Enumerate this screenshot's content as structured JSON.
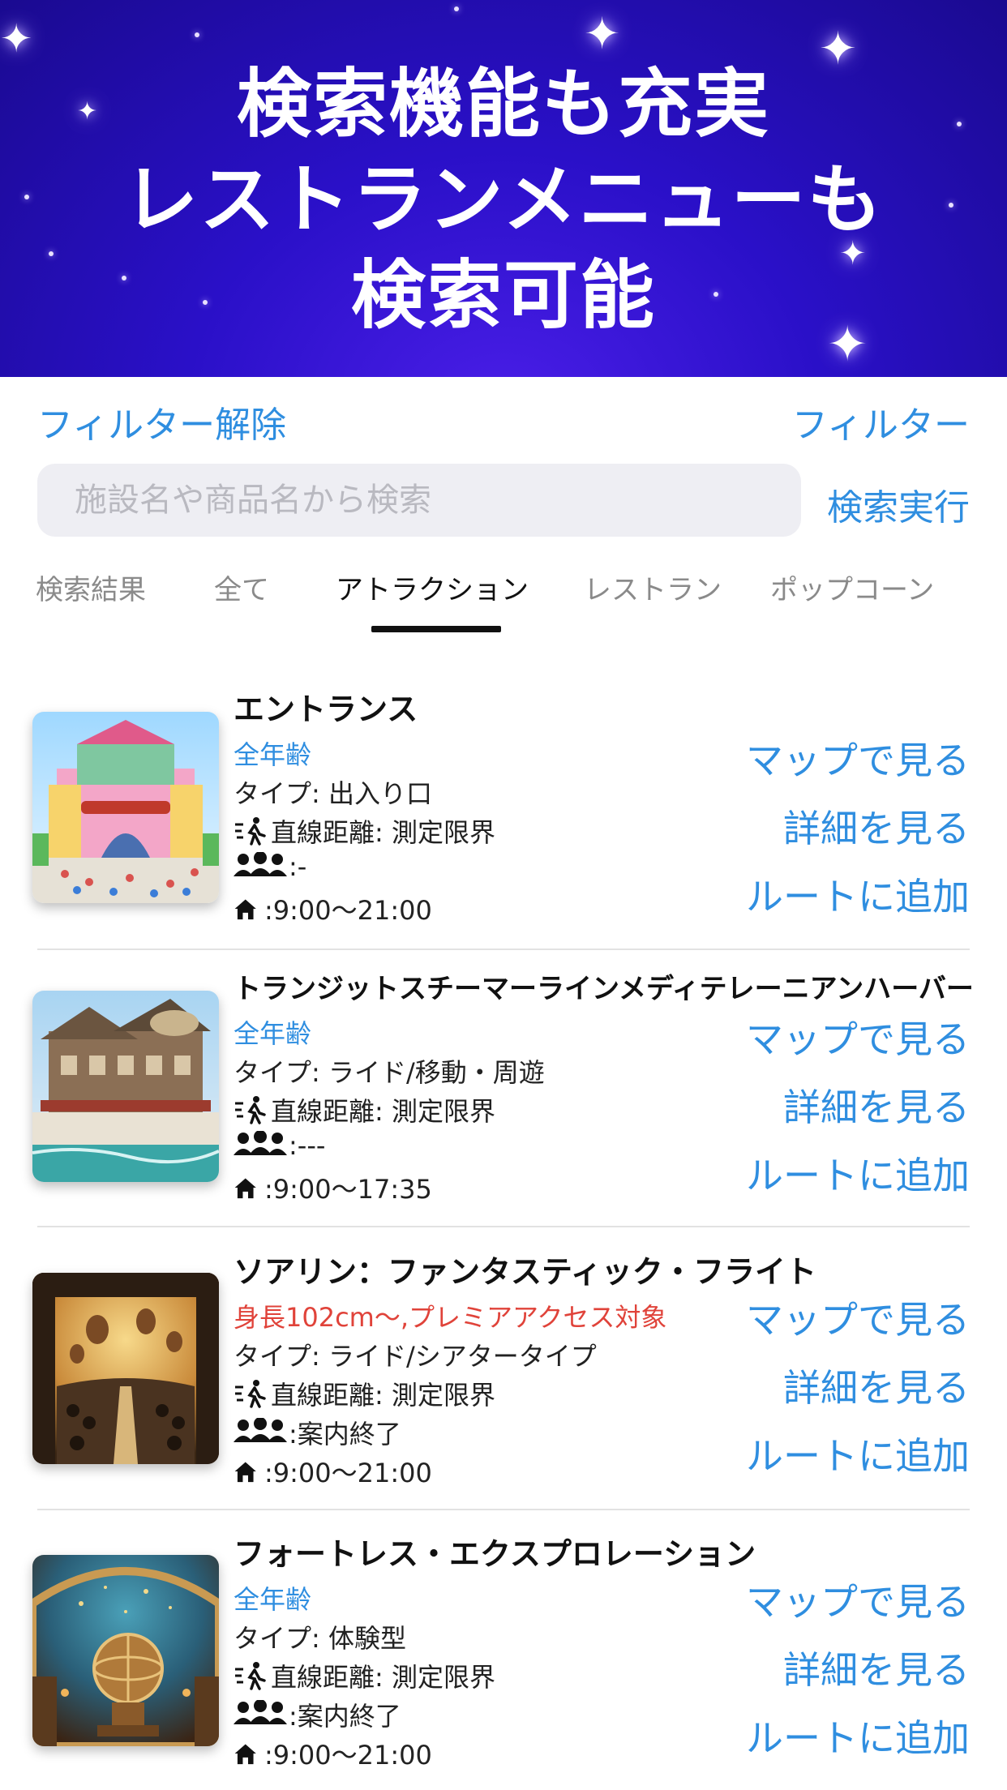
{
  "banner": {
    "line1": "検索機能も充実",
    "line2": "レストランメニューも",
    "line3": "検索可能"
  },
  "filter": {
    "clear_label": "フィルター解除",
    "filter_label": "フィルター"
  },
  "search": {
    "placeholder": "施設名や商品名から検索",
    "value": "",
    "exec_label": "検索実行"
  },
  "tabs": [
    {
      "label": "検索結果",
      "active": false
    },
    {
      "label": "全て",
      "active": false
    },
    {
      "label": "アトラクション",
      "active": true
    },
    {
      "label": "レストラン",
      "active": false
    },
    {
      "label": "ポップコーン",
      "active": false
    }
  ],
  "actions": {
    "map": "マップで見る",
    "detail": "詳細を見る",
    "route": "ルートに追加"
  },
  "items": [
    {
      "name": "エントランス",
      "age": "全年齢",
      "type": "タイプ: 出入り口",
      "distance": "直線距離: 測定限界",
      "wait": ":-",
      "hours": ":9:00～21:00"
    },
    {
      "name": "トランジットスチーマーラインメディテレーニアンハーバー",
      "age": "全年齢",
      "type": "タイプ: ライド/移動・周遊",
      "distance": "直線距離: 測定限界",
      "wait": ":---",
      "hours": ":9:00～17:35"
    },
    {
      "name": "ソアリン：ファンタスティック・フライト",
      "age": "身長102cm～,プレミアアクセス対象",
      "type": "タイプ: ライド/シアタータイプ",
      "distance": "直線距離: 測定限界",
      "wait": ":案内終了",
      "hours": ":9:00～21:00"
    },
    {
      "name": "フォートレス・エクスプロレーション",
      "age": "全年齢",
      "type": "タイプ: 体験型",
      "distance": "直線距離: 測定限界",
      "wait": ":案内終了",
      "hours": ":9:00～21:00"
    }
  ],
  "colors": {
    "accent": "#2f8ee0",
    "warning": "#e0433a",
    "banner": "#2a10c8"
  },
  "icons": [
    "walking-person-icon",
    "group-icon",
    "home-icon",
    "sparkle-star-icon"
  ]
}
